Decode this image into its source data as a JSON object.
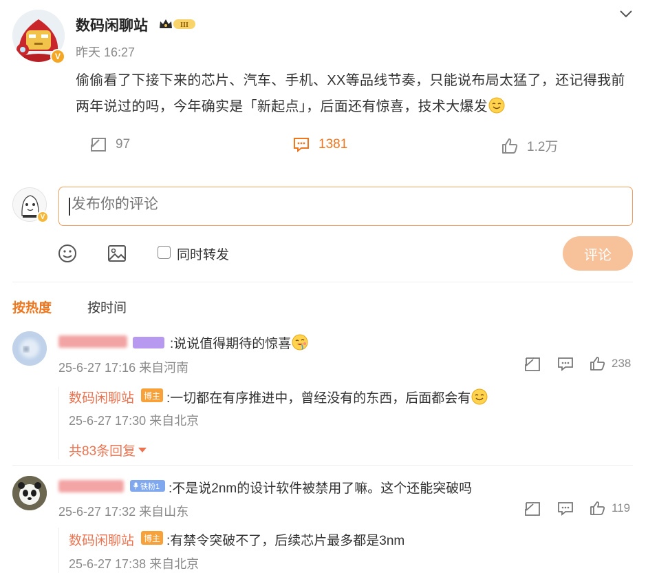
{
  "post": {
    "author": "数码闲聊站",
    "level_badge": "III",
    "time": "昨天 16:27",
    "text": "偷偷看了下接下来的芯片、汽车、手机、XX等品线节奏，只能说布局太猛了，还记得我前两年说过的吗，今年确实是「新起点」，后面还有惊喜，技术大爆发",
    "text_emoji": "smiling-face-emoji",
    "repost_count": "97",
    "comment_count": "1381",
    "like_count": "1.2万",
    "verify_badge": "V",
    "menu_icon": "chevron-down-icon"
  },
  "composer": {
    "placeholder": "发布你的评论",
    "repost_label": "同时转发",
    "submit_label": "评论",
    "emoji_icon": "emoji-icon",
    "image_icon": "image-icon"
  },
  "sort_tabs": {
    "hot": "按热度",
    "time": "按时间"
  },
  "comments": [
    {
      "text": ":说说值得期待的惊喜",
      "emoji": "drooling-face-emoji",
      "meta": "25-6-27 17:16 来自河南",
      "likes": "238",
      "reply": {
        "author": "数码闲聊站",
        "tag": "博主",
        "text": ":一切都在有序推进中，曾经没有的东西，后面都会有",
        "emoji": "smiling-face-emoji",
        "meta": "25-6-27 17:30 来自北京"
      },
      "more_replies": "共83条回复"
    },
    {
      "fan_badge": "铁粉1",
      "text": ":不是说2nm的设计软件被禁用了嘛。这个还能突破吗",
      "meta": "25-6-27 17:32 来自山东",
      "likes": "119",
      "reply": {
        "author": "数码闲聊站",
        "tag": "博主",
        "text": ":有禁令突破不了，后续芯片最多都是3nm",
        "meta": "25-6-27 17:38 来自北京"
      }
    }
  ],
  "colors": {
    "accent": "#f0761e",
    "reply_name": "#eb7350",
    "submit_disabled": "#f7c29a",
    "meta": "#8a8a8a"
  }
}
